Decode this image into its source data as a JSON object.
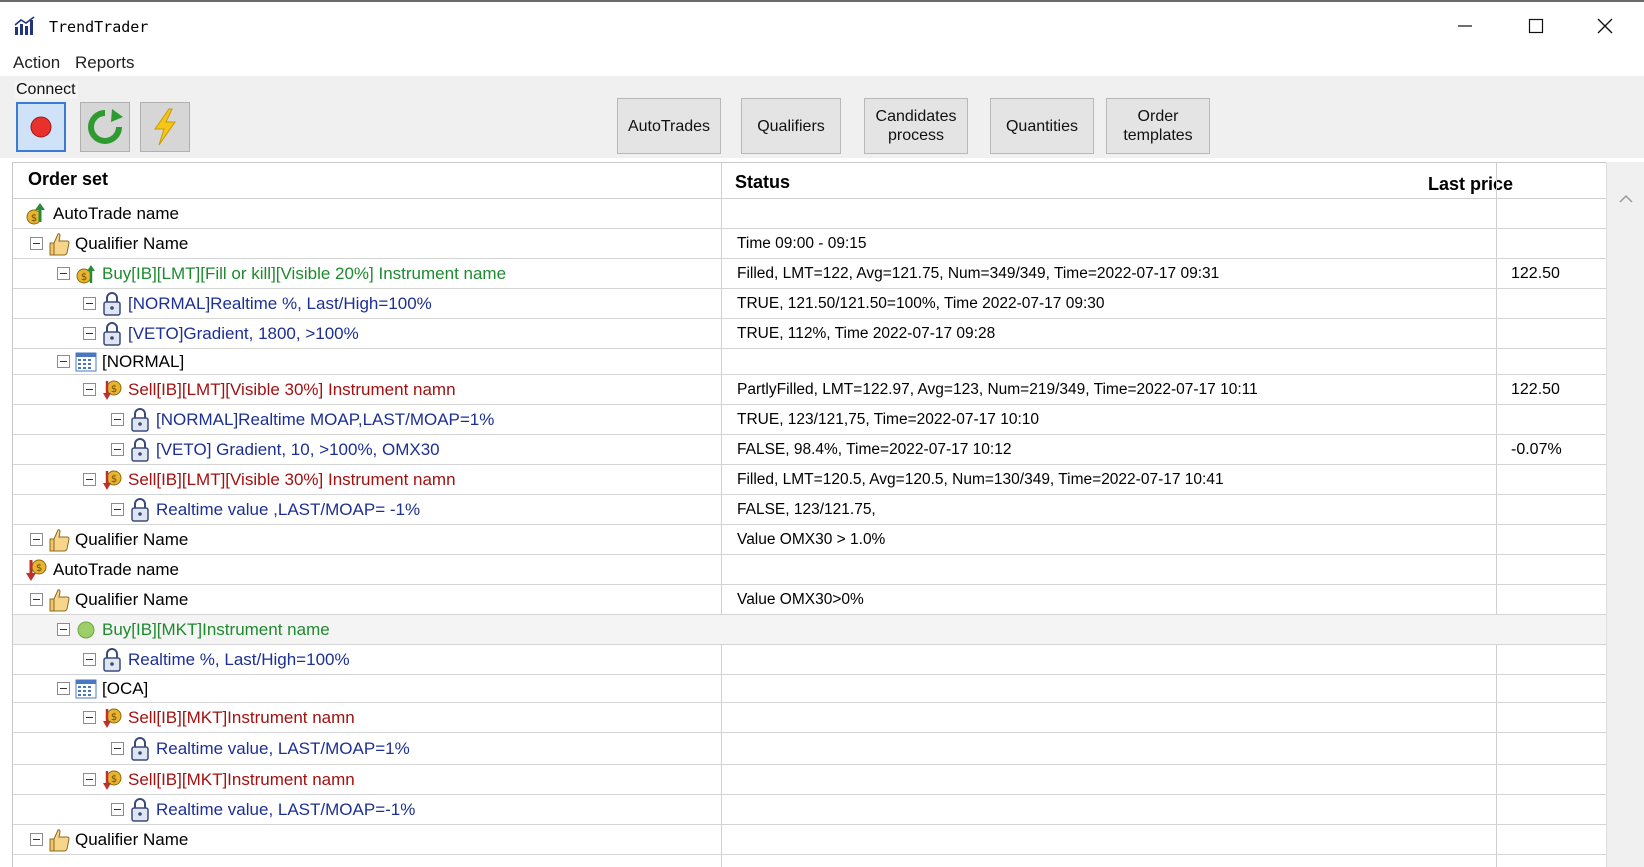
{
  "window": {
    "title": "TrendTrader",
    "minimize_label": "minimize",
    "maximize_label": "maximize",
    "close_label": "close"
  },
  "menu": {
    "action": "Action",
    "reports": "Reports"
  },
  "toolbar": {
    "connect_label": "Connect",
    "buttons": {
      "autotrades": "AutoTrades",
      "qualifiers": "Qualifiers",
      "candidates_line1": "Candidates",
      "candidates_line2": "process",
      "quantities": "Quantities",
      "order_line1": "Order",
      "order_line2": "templates"
    }
  },
  "grid": {
    "columns": {
      "order_set": "Order set",
      "status": "Status",
      "last_price": "Last price"
    },
    "rows": [
      {
        "label": "AutoTrade name",
        "status": "",
        "price": "",
        "icon": "autotrade-up-icon",
        "color": "black"
      },
      {
        "label": "Qualifier Name",
        "status": "Time 09:00 - 09:15",
        "price": "",
        "icon": "thumbs-up-icon",
        "color": "black"
      },
      {
        "label": "Buy[IB][LMT][Fill or kill][Visible 20%] Instrument name",
        "status": "Filled, LMT=122, Avg=121.75, Num=349/349, Time=2022-07-17 09:31",
        "price": "122.50",
        "icon": "buy-order-icon",
        "color": "green"
      },
      {
        "label": "[NORMAL]Realtime %, Last/High=100%",
        "status": "TRUE, 121.50/121.50=100%, Time 2022-07-17 09:30",
        "price": "",
        "icon": "lock-icon",
        "color": "blue"
      },
      {
        "label": "[VETO]Gradient, 1800, >100%",
        "status": "TRUE, 112%, Time 2022-07-17 09:28",
        "price": "",
        "icon": "lock-icon",
        "color": "blue"
      },
      {
        "label": "[NORMAL]",
        "status": "",
        "price": "",
        "icon": "calendar-grid-icon",
        "color": "black"
      },
      {
        "label": "Sell[IB][LMT][Visible 30%] Instrument namn",
        "status": "PartlyFilled, LMT=122.97, Avg=123, Num=219/349, Time=2022-07-17 10:11",
        "price": "122.50",
        "icon": "sell-order-icon",
        "color": "red"
      },
      {
        "label": "[NORMAL]Realtime MOAP,LAST/MOAP=1%",
        "status": "TRUE, 123/121,75, Time=2022-07-17 10:10",
        "price": "",
        "icon": "lock-icon",
        "color": "blue"
      },
      {
        "label": "[VETO] Gradient, 10, >100%, OMX30",
        "status": "FALSE, 98.4%, Time=2022-07-17 10:12",
        "price": "-0.07%",
        "icon": "lock-icon",
        "color": "blue"
      },
      {
        "label": "Sell[IB][LMT][Visible 30%] Instrument namn",
        "status": "Filled, LMT=120.5, Avg=120.5, Num=130/349, Time=2022-07-17 10:41",
        "price": "",
        "icon": "sell-order-icon",
        "color": "red"
      },
      {
        "label": "Realtime value ,LAST/MOAP= -1%",
        "status": "FALSE, 123/121.75,",
        "price": "",
        "icon": "lock-icon",
        "color": "blue"
      },
      {
        "label": "Qualifier Name",
        "status": "Value OMX30 > 1.0%",
        "price": "",
        "icon": "thumbs-up-icon",
        "color": "black"
      },
      {
        "label": "AutoTrade name",
        "status": "",
        "price": "",
        "icon": "autotrade-down-icon",
        "color": "black"
      },
      {
        "label": "Qualifier Name",
        "status": "Value OMX30>0%",
        "price": "",
        "icon": "thumbs-up-icon",
        "color": "black"
      },
      {
        "label": "Buy[IB][MKT]Instrument name",
        "status": "",
        "price": "",
        "icon": "green-dot-icon",
        "color": "green"
      },
      {
        "label": "Realtime %, Last/High=100%",
        "status": "",
        "price": "",
        "icon": "lock-icon",
        "color": "blue"
      },
      {
        "label": "[OCA]",
        "status": "",
        "price": "",
        "icon": "calendar-grid-icon",
        "color": "black"
      },
      {
        "label": "Sell[IB][MKT]Instrument namn",
        "status": "",
        "price": "",
        "icon": "sell-order-icon",
        "color": "red"
      },
      {
        "label": "Realtime value, LAST/MOAP=1%",
        "status": "",
        "price": "",
        "icon": "lock-icon",
        "color": "blue"
      },
      {
        "label": "Sell[IB][MKT]Instrument namn",
        "status": "",
        "price": "",
        "icon": "sell-order-icon",
        "color": "red"
      },
      {
        "label": "Realtime value, LAST/MOAP=-1%",
        "status": "",
        "price": "",
        "icon": "lock-icon",
        "color": "blue"
      },
      {
        "label": "Qualifier Name",
        "status": "",
        "price": "",
        "icon": "thumbs-up-icon",
        "color": "black"
      }
    ]
  },
  "colors": {
    "buy": "#1e8a2e",
    "sell": "#a31010",
    "condition": "#1c2f94"
  }
}
